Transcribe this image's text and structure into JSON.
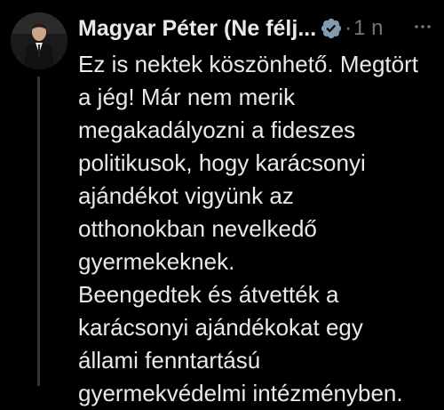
{
  "tweet": {
    "author_name": "Magyar Péter (Ne félj...",
    "separator": "·",
    "timestamp": "1 n",
    "more_icon": "more-horizontal-icon",
    "verified_icon": "verified-badge-icon",
    "text": "Ez is nektek köszönhető. Megtört\na jég! Már nem merik\nmegakadályozni a fideszes\npolitikusok, hogy karácsonyi\najándékot vigyünk az\notthonokban nevelkedő\ngyermekeknek.\nBeengedtek és átvették a\nkarácsonyi ajándékokat egy\nállami fenntartású\ngyermekvédelmi intézményben."
  },
  "colors": {
    "background": "#000000",
    "primary_text": "#e7e9ea",
    "secondary_text": "#71767b",
    "verified_badge": "#829aab",
    "thread_line": "#333639"
  }
}
